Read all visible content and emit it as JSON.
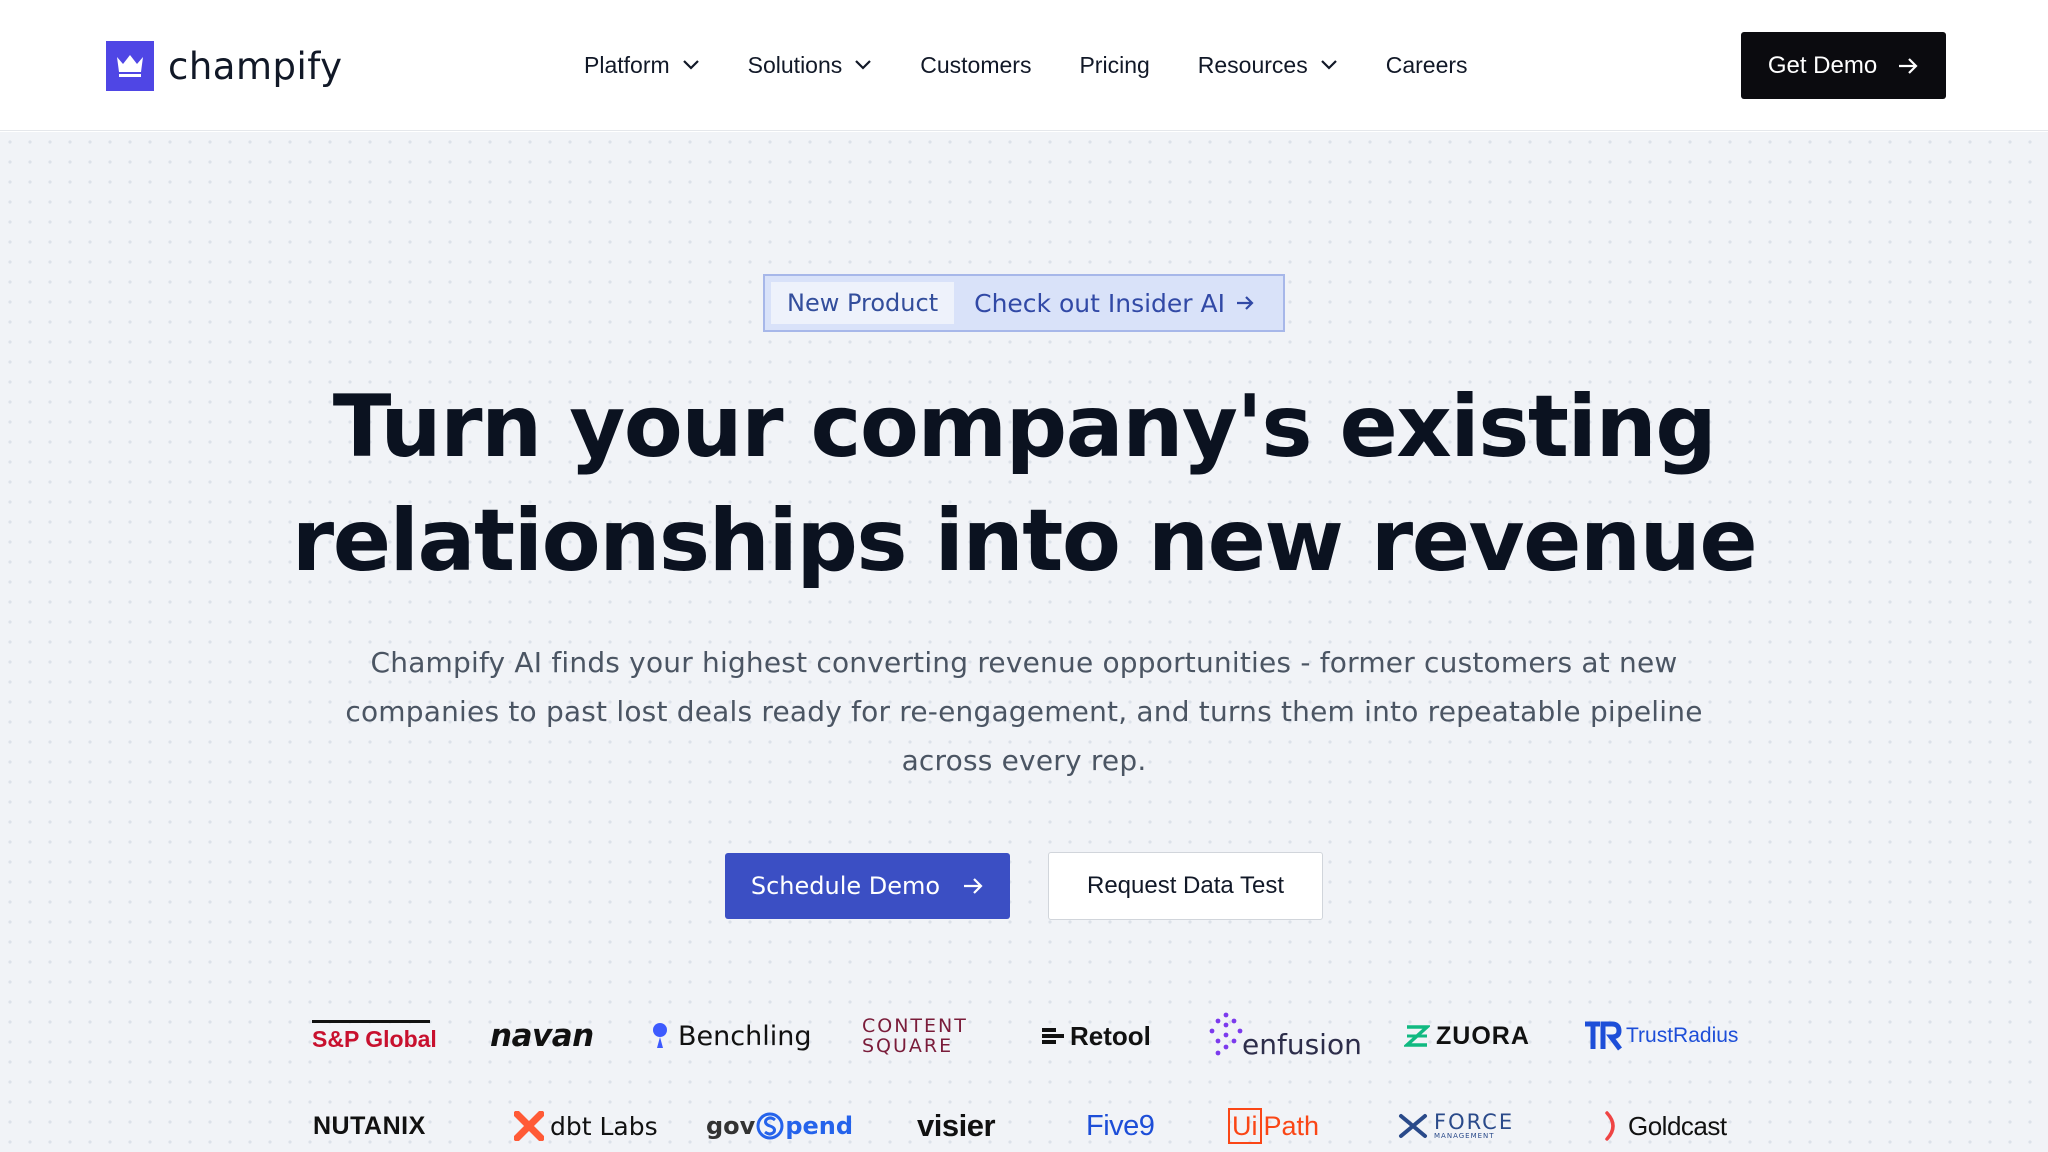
{
  "brand": {
    "name": "champify",
    "color": "#4f46e5"
  },
  "nav": {
    "items": [
      {
        "label": "Platform",
        "dropdown": true
      },
      {
        "label": "Solutions",
        "dropdown": true
      },
      {
        "label": "Customers",
        "dropdown": false
      },
      {
        "label": "Pricing",
        "dropdown": false
      },
      {
        "label": "Resources",
        "dropdown": true
      },
      {
        "label": "Careers",
        "dropdown": false
      }
    ],
    "cta": "Get Demo"
  },
  "hero": {
    "badge_tag": "New Product",
    "badge_link": "Check out Insider AI",
    "headline_line1": "Turn your company's existing",
    "headline_line2": "relationships into new revenue",
    "sub_line1": "Champify AI finds your highest converting revenue opportunities - former customers at new",
    "sub_line2": "companies to past lost deals ready for re-engagement, and turns them into repeatable pipeline",
    "sub_line3": "across every rep.",
    "primary_cta": "Schedule Demo",
    "secondary_cta": "Request Data Test"
  },
  "customer_logos": {
    "row1": [
      "S&P Global",
      "navan",
      "Benchling",
      "CONTENT",
      "SQUARE",
      "Retool",
      "enfusion",
      "ZUORA",
      "TrustRadius"
    ],
    "row2": [
      "NUTANIX",
      "dbt Labs",
      "gov",
      "pend",
      "visier",
      "Five9",
      "Ui",
      "Path",
      "FORCE",
      "MANAGEMENT",
      "Goldcast"
    ]
  }
}
